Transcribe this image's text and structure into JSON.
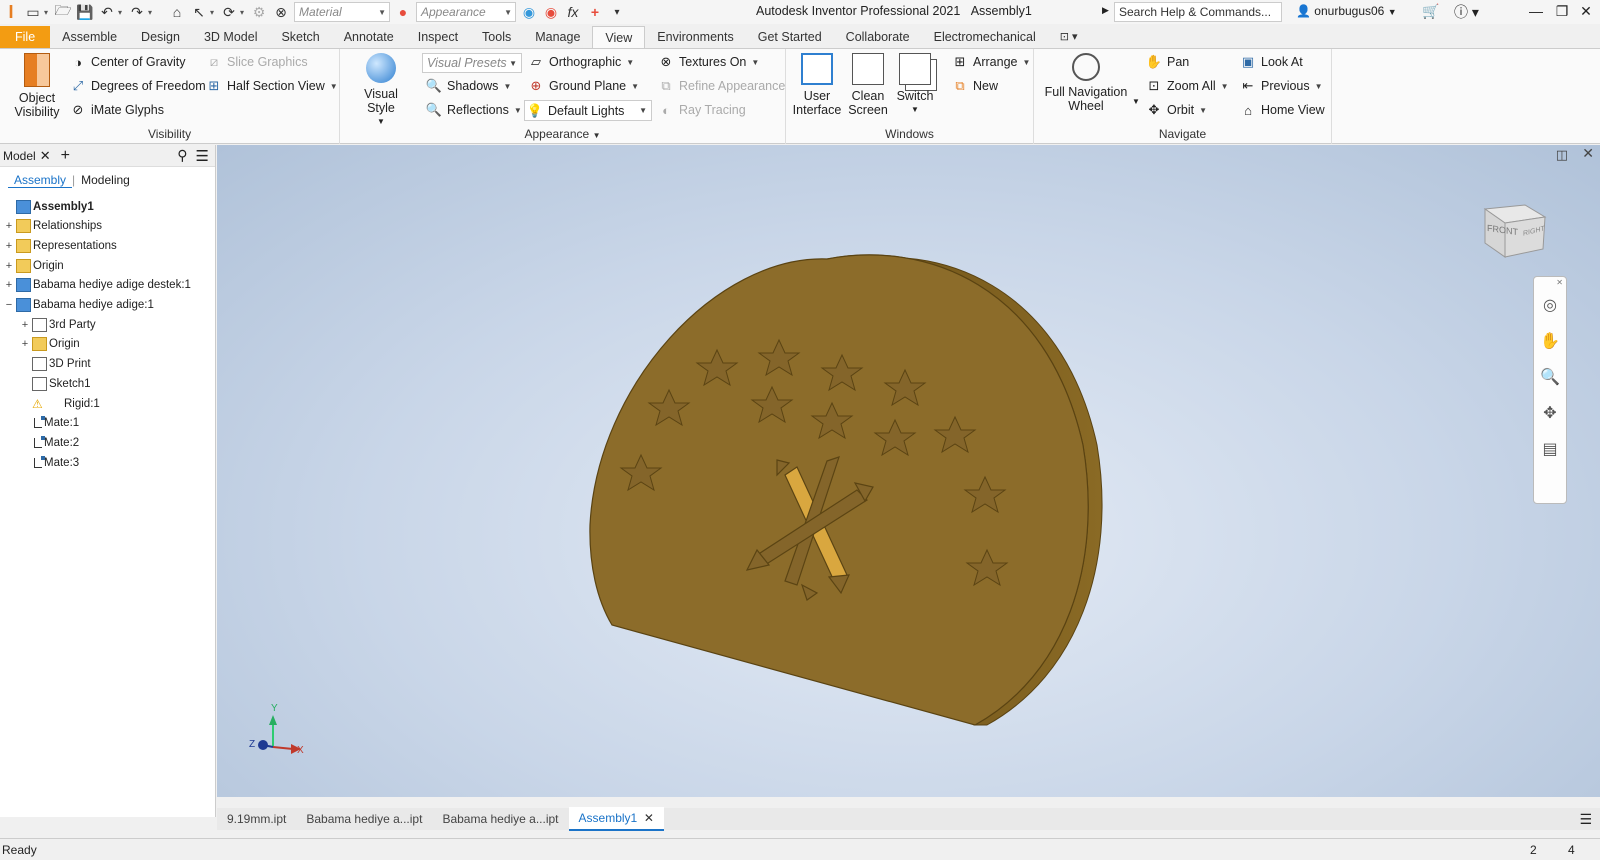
{
  "window": {
    "title": "Autodesk Inventor Professional 2021",
    "document": "Assembly1",
    "search_placeholder": "Search Help & Commands...",
    "user": "onurbugus06"
  },
  "quick_access": {
    "material_value": "Material",
    "appearance_value": "Appearance"
  },
  "ribbon_tabs": [
    "File",
    "Assemble",
    "Design",
    "3D Model",
    "Sketch",
    "Annotate",
    "Inspect",
    "Tools",
    "Manage",
    "View",
    "Environments",
    "Get Started",
    "Collaborate",
    "Electromechanical"
  ],
  "active_tab": "View",
  "ribbon": {
    "visibility": {
      "label": "Visibility",
      "object_visibility": "Object\nVisibility",
      "center_of_gravity": "Center of Gravity",
      "degrees_of_freedom": "Degrees of Freedom",
      "imate_glyphs": "iMate Glyphs",
      "slice_graphics": "Slice Graphics",
      "half_section_view": "Half Section View"
    },
    "appearance": {
      "label": "Appearance",
      "visual_style": "Visual Style",
      "visual_presets": "Visual Presets",
      "shadows": "Shadows",
      "reflections": "Reflections",
      "orthographic": "Orthographic",
      "ground_plane": "Ground Plane",
      "default_lights": "Default Lights",
      "textures_on": "Textures On",
      "refine_appearance": "Refine Appearance",
      "ray_tracing": "Ray Tracing"
    },
    "windows": {
      "label": "Windows",
      "user_interface": "User\nInterface",
      "clean_screen": "Clean\nScreen",
      "switch": "Switch",
      "arrange": "Arrange",
      "new": "New"
    },
    "navigate": {
      "label": "Navigate",
      "full_navigation_wheel": "Full Navigation\nWheel",
      "pan": "Pan",
      "zoom_all": "Zoom All",
      "orbit": "Orbit",
      "look_at": "Look At",
      "previous": "Previous",
      "home_view": "Home View"
    }
  },
  "browser": {
    "title": "Model",
    "tab_assembly": "Assembly",
    "tab_modeling": "Modeling",
    "tree": [
      {
        "label": "Assembly1",
        "icon": "assembly-icon",
        "expander": "",
        "bold": true
      },
      {
        "label": "Relationships",
        "icon": "folder-icon",
        "expander": "+"
      },
      {
        "label": "Representations",
        "icon": "folder-icon",
        "expander": "+"
      },
      {
        "label": "Origin",
        "icon": "folder-icon",
        "expander": "+"
      },
      {
        "label": "Babama hediye adige destek:1",
        "icon": "part-icon",
        "expander": "+"
      },
      {
        "label": "Babama hediye adige:1",
        "icon": "part-icon",
        "expander": "−"
      },
      {
        "label": "3rd Party",
        "icon": "3rd-party-icon",
        "expander": "+"
      },
      {
        "label": "Origin",
        "icon": "folder-icon",
        "expander": "+"
      },
      {
        "label": "3D Print",
        "icon": "3d-print-icon",
        "expander": ""
      },
      {
        "label": "Sketch1",
        "icon": "sketch-icon",
        "expander": ""
      },
      {
        "label": "Rigid:1",
        "icon": "rigid-joint-icon",
        "expander": ""
      },
      {
        "label": "Mate:1",
        "icon": "mate-icon",
        "expander": ""
      },
      {
        "label": "Mate:2",
        "icon": "mate-icon",
        "expander": ""
      },
      {
        "label": "Mate:3",
        "icon": "mate-icon",
        "expander": ""
      }
    ]
  },
  "viewport": {
    "viewcube_front": "FRONT",
    "viewcube_right": "RIGHT",
    "axis_x": "X",
    "axis_y": "Y",
    "axis_z": "Z",
    "model_color": "#8c6c2a"
  },
  "doc_tabs": [
    "9.19mm.ipt",
    "Babama hediye a...ipt",
    "Babama hediye a...ipt",
    "Assembly1"
  ],
  "active_doc": "Assembly1",
  "status": {
    "text": "Ready",
    "count1": "2",
    "count2": "4"
  }
}
